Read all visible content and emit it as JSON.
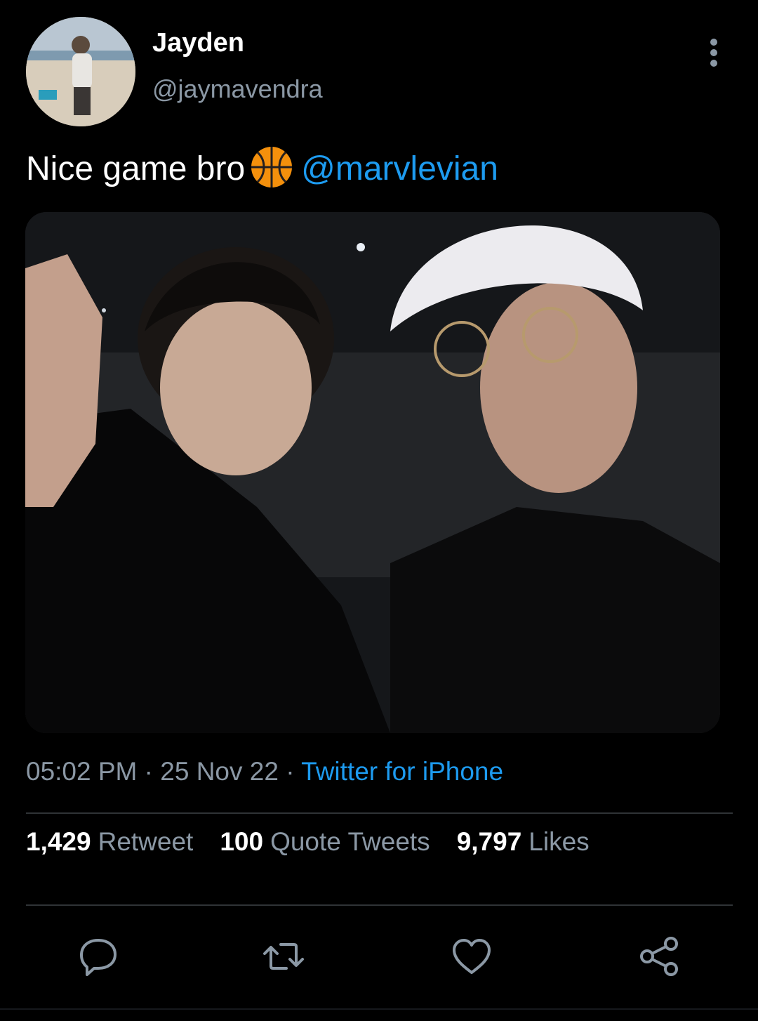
{
  "author": {
    "display_name": "Jayden",
    "handle": "@jaymavendra"
  },
  "tweet": {
    "text_before": "Nice game bro",
    "emoji_icon": "basketball-icon",
    "mention": "@marvlevian"
  },
  "meta": {
    "time": "05:02 PM",
    "separator": " · ",
    "date": "25 Nov 22",
    "source": "Twitter for iPhone"
  },
  "stats": {
    "retweets": {
      "count": "1,429",
      "label": "Retweet"
    },
    "quotes": {
      "count": "100",
      "label": "Quote Tweets"
    },
    "likes": {
      "count": "9,797",
      "label": "Likes"
    }
  },
  "actions": [
    "reply-icon",
    "retweet-icon",
    "like-icon",
    "share-icon"
  ],
  "colors": {
    "background": "#000000",
    "link": "#1d9bf0",
    "secondary_text": "#8b98a5",
    "divider": "#2f3336"
  }
}
